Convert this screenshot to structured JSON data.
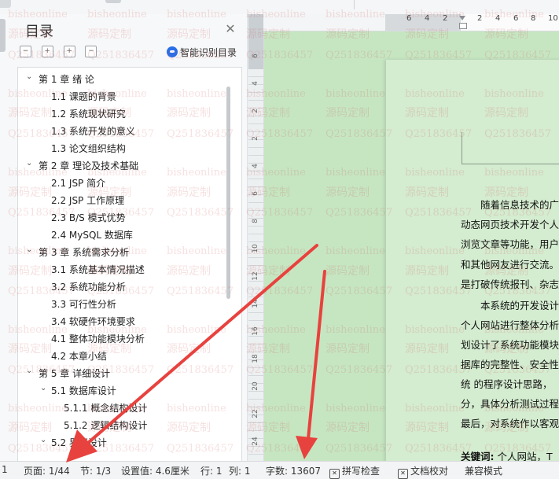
{
  "toc": {
    "title": "目录",
    "smart_label": "智能识别目录",
    "tools": [
      "−",
      "+",
      "+",
      "−"
    ],
    "items": [
      {
        "label": "第 1 章  绪  论",
        "level": 1
      },
      {
        "label": "1.1  课题的背景",
        "level": 2
      },
      {
        "label": "1.2  系统现状研究",
        "level": 2
      },
      {
        "label": "1.3  系统开发的意义",
        "level": 2
      },
      {
        "label": "1.3  论文组织结构",
        "level": 2
      },
      {
        "label": "第 2 章  理论及技术基础",
        "level": 1
      },
      {
        "label": "2.1  JSP 简介",
        "level": 2
      },
      {
        "label": "2.2  JSP 工作原理",
        "level": 2
      },
      {
        "label": "2.3  B/S 模式优势",
        "level": 2
      },
      {
        "label": "2.4  MySQL 数据库",
        "level": 2
      },
      {
        "label": "第 3 章  系统需求分析",
        "level": 1
      },
      {
        "label": "3.1  系统基本情况描述",
        "level": 2
      },
      {
        "label": "3.2  系统功能分析",
        "level": 2
      },
      {
        "label": "3.3  可行性分析",
        "level": 2
      },
      {
        "label": "3.4  软硬件环境要求",
        "level": 2
      },
      {
        "label": "4.1  整体功能模块分析",
        "level": 2
      },
      {
        "label": "4.2  本章小结",
        "level": 2
      },
      {
        "label": "第 5 章  详细设计",
        "level": 1
      },
      {
        "label": "5.1  数据库设计",
        "level": 2,
        "expandable": true
      },
      {
        "label": "5.1.1  概念结构设计",
        "level": 3
      },
      {
        "label": "5.1.2  逻辑结构设计",
        "level": 3
      },
      {
        "label": "5.2  界面设计",
        "level": 2,
        "expandable": true
      }
    ]
  },
  "ruler": {
    "h_numbers": [
      "6",
      "4",
      "2",
      "2",
      "4",
      "6",
      "8",
      "10"
    ],
    "v_numbers": [
      "6",
      "4",
      "2",
      "2",
      "4",
      "6",
      "8",
      "10",
      "12",
      "14",
      "16",
      "18",
      "20",
      "22",
      "24"
    ]
  },
  "document": {
    "paragraphs": [
      "随着信息技术的广",
      "动态网页技术开发个人",
      "浏览文章等功能，用户",
      "和其他网友进行交流。",
      "是打破传统报刊、杂志",
      "本系统的开发设计",
      "个人网站进行整体分析",
      "划设计了系统功能模块",
      "据库的完整性、安全性",
      "统 的程序设计思路，",
      "分，具体分析测试过程",
      "最后，对系统作以客观"
    ],
    "keywords_label": "关键词:",
    "keywords_text": " 个人网站，T"
  },
  "status": {
    "page": "页面: 1/44",
    "section": "节: 1/3",
    "setting": "设置值: 4.6厘米",
    "row": "行: 1",
    "col": "列: 1",
    "words": "字数: 13607",
    "spell": "拼写检查",
    "proof": "文档校对",
    "compat": "兼容模式",
    "left_fragment": "1"
  },
  "watermark": {
    "texts": [
      "bisheonline",
      "源码定制",
      "Q2518364​57"
    ]
  },
  "colors": {
    "document_bg": "#c6e6c2",
    "arrow": "#e8423e",
    "watermark_text": "#cc4444",
    "link_blue": "#2b6fe8"
  }
}
